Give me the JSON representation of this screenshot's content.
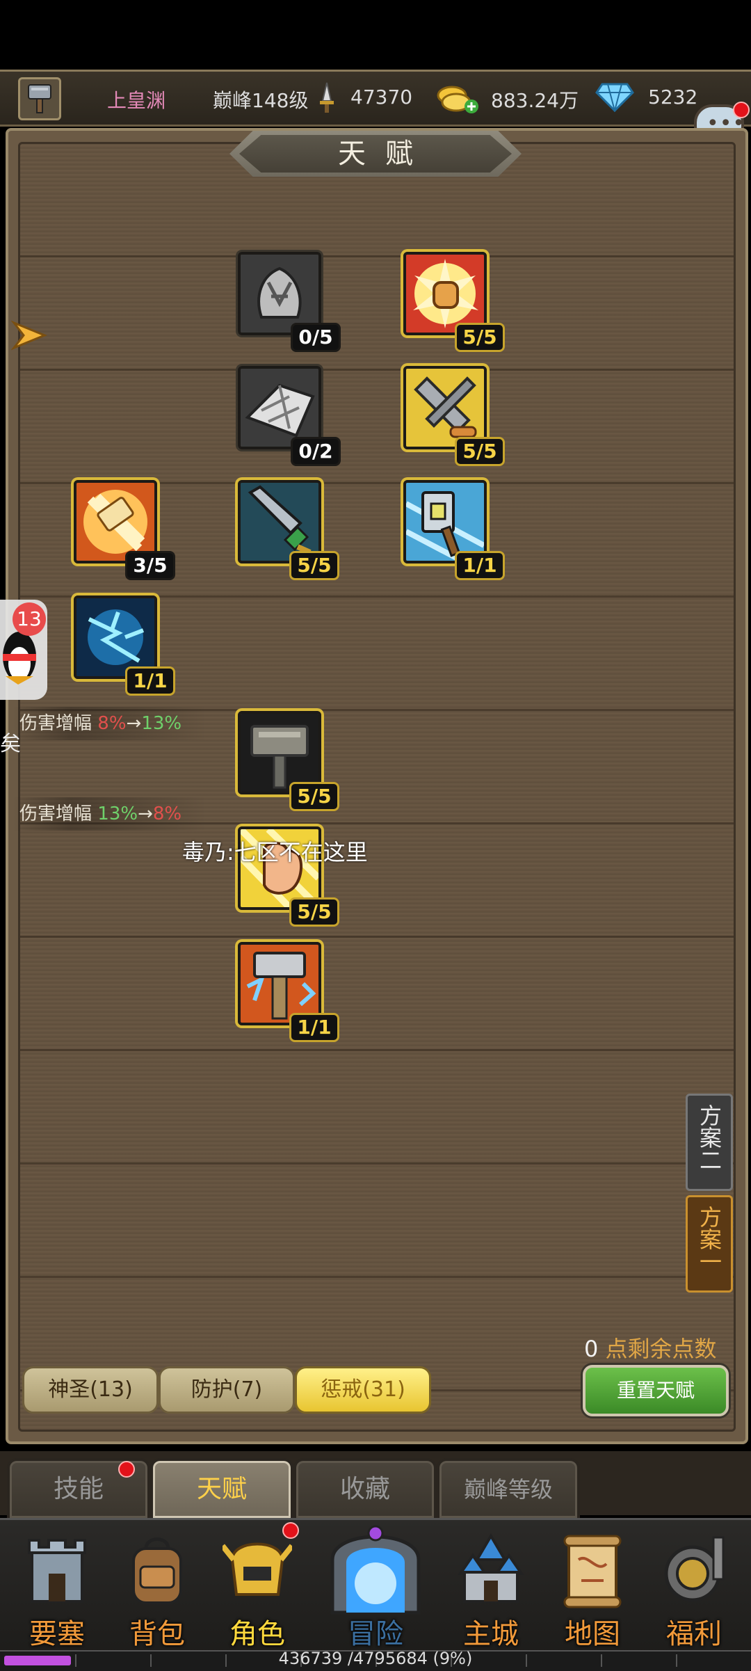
{
  "header": {
    "player_name": "上皇渊",
    "peak_level": "巅峰148级",
    "power": "47370",
    "gold": "883.24万",
    "diamonds": "5232",
    "chat_label": "聊天"
  },
  "panel": {
    "title": "天赋"
  },
  "talents": [
    {
      "id": "claw-gray",
      "badge": "0/5"
    },
    {
      "id": "fist-burst",
      "badge": "5/5"
    },
    {
      "id": "wings-gray",
      "badge": "0/2"
    },
    {
      "id": "sword-clash",
      "badge": "5/5"
    },
    {
      "id": "hammer-burst",
      "badge": "3/5"
    },
    {
      "id": "blade-teal",
      "badge": "5/5"
    },
    {
      "id": "hammer-ice",
      "badge": "1/1"
    },
    {
      "id": "lightning",
      "badge": "1/1"
    },
    {
      "id": "iron-hammer",
      "badge": "5/5"
    },
    {
      "id": "fist-strike",
      "badge": "5/5"
    },
    {
      "id": "thunder-hammer",
      "badge": "1/1"
    }
  ],
  "floating": {
    "dmg1_label": "伤害增幅",
    "dmg1_from": "8%",
    "dmg1_arrow": "→",
    "dmg1_to": "13%",
    "dmg2_label": "伤害增幅",
    "dmg2_from": "13%",
    "dmg2_arrow": "→",
    "dmg2_to": "8%",
    "chat_message": "毒乃:七区不在这里",
    "qq_badge": "13",
    "side_letter": "矣"
  },
  "plans": {
    "plan2": "方案二",
    "plan1": "方案一"
  },
  "points": {
    "value": "0",
    "label": "点剩余点数"
  },
  "categories": [
    {
      "label": "神圣(13)"
    },
    {
      "label": "防护(7)"
    },
    {
      "label": "惩戒(31)"
    }
  ],
  "reset_label": "重置天赋",
  "subtabs": [
    {
      "label": "技能"
    },
    {
      "label": "天赋"
    },
    {
      "label": "收藏"
    },
    {
      "label": "巅峰等级"
    }
  ],
  "nav": [
    {
      "label": "要塞"
    },
    {
      "label": "背包"
    },
    {
      "label": "角色"
    },
    {
      "label": "冒险"
    },
    {
      "label": "主城"
    },
    {
      "label": "地图"
    },
    {
      "label": "福利"
    }
  ],
  "exp": {
    "text": "436739 /4795684 (9%)",
    "fraction": 0.09
  },
  "colors": {
    "active_border": "#d9b93a",
    "badge_gold": "#f7d447",
    "selected_category": "#f4d43e",
    "reset_green": "#4fa535",
    "nav_label": "#f29a3a",
    "exp_fill": "#c251e0"
  }
}
